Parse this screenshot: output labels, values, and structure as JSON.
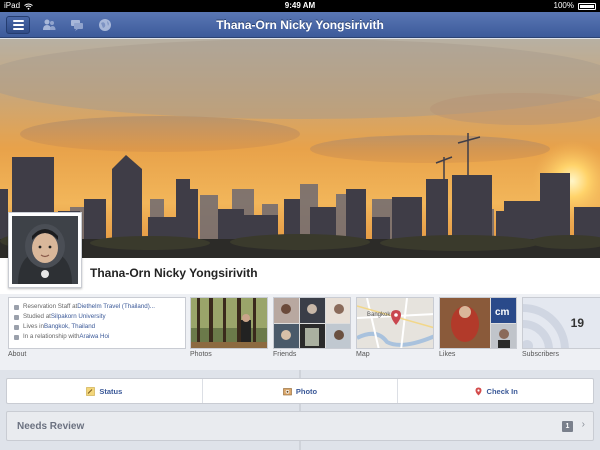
{
  "status_bar": {
    "device": "iPad",
    "time": "9:49 AM",
    "battery": "100%"
  },
  "navbar": {
    "title": "Thana-Orn Nicky Yongsirivith",
    "icons": [
      "menu-icon",
      "friends-icon",
      "messages-icon",
      "globe-icon"
    ]
  },
  "profile": {
    "name": "Thana-Orn Nicky Yongsirivith"
  },
  "about": {
    "lines": [
      {
        "prefix": "Reservation Staff at ",
        "link": "Diethelm Travel (Thailand)..."
      },
      {
        "prefix": "Studied at ",
        "link": "Silpakorn University"
      },
      {
        "prefix": "Lives in ",
        "link": "Bangkok, Thailand"
      },
      {
        "prefix": "In a relationship with ",
        "link": "Araiwa Hoi"
      }
    ],
    "label": "About"
  },
  "tiles": {
    "photos_label": "Photos",
    "friends_label": "Friends",
    "map_label": "Map",
    "map_city": "Bangkok",
    "likes_label": "Likes",
    "subscribers_label": "Subscribers",
    "subscribers_count": "19"
  },
  "actions": {
    "status": "Status",
    "photo": "Photo",
    "checkin": "Check In"
  },
  "review": {
    "title": "Needs Review",
    "count": "1"
  },
  "colors": {
    "brand": "#3b5998",
    "navbar": "#4a68a8"
  }
}
